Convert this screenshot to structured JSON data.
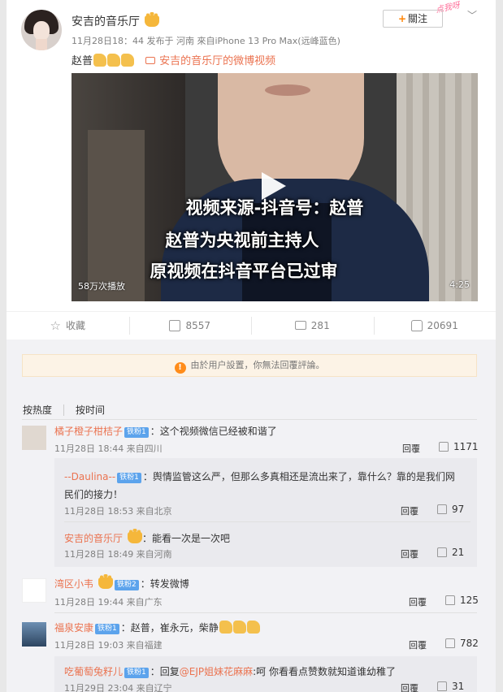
{
  "post": {
    "username": "安吉的音乐厅",
    "meta": "11月28日18：44 发布于 河南 來自iPhone 13 Pro Max(远峰蓝色)",
    "text": "赵普",
    "video_link": "安吉的音乐厅的微博视频",
    "follow_label": "關注",
    "sticker": "点我呀"
  },
  "video": {
    "caption_1": "视频来源-抖音号：赵普",
    "caption_2": "赵普为央视前主持人",
    "caption_3": "原视频在抖音平台已过审",
    "plays": "58万次播放",
    "duration": "4:25"
  },
  "actions": {
    "favorite": "收藏",
    "repost_count": "8557",
    "comment_count": "281",
    "like_count": "20691"
  },
  "notice": "由於用户設置，你無法回覆評論。",
  "sort": {
    "hot": "按热度",
    "time": "按时间"
  },
  "comments": [
    {
      "name": "橘子橙子柑桔子",
      "badge": "铁粉1",
      "text": "：这个视频微信已经被和谐了",
      "meta": "11月28日 18:44 来自四川",
      "reply": "回覆",
      "likes": "1171"
    },
    {
      "name": "--Daulina--",
      "badge": "铁粉1",
      "text_1": "：舆情监管这么严，但那么多真相还是流出来了，靠什么？靠的是我们网",
      "text_2": "民们的接力！",
      "meta": "11月28日 18:53 来自北京",
      "reply": "回覆",
      "likes": "97"
    },
    {
      "name": "安吉的音乐厅",
      "text": "：能看一次是一次吧",
      "meta": "11月28日 18:49 来自河南",
      "reply": "回覆",
      "likes": "21"
    },
    {
      "name": "湾区小韦",
      "badge": "铁粉2",
      "text": "：转发微博",
      "meta": "11月28日 19:44 来自广东",
      "reply": "回覆",
      "likes": "125"
    },
    {
      "name": "福泉安康",
      "badge": "铁粉1",
      "text": "：赵普，崔永元，柴静",
      "meta": "11月28日 19:03 来自福建",
      "reply": "回覆",
      "likes": "782"
    },
    {
      "name": "吃葡萄兔籽儿",
      "badge": "铁粉1",
      "text_pre": "：回复",
      "mention": "@EJP姐妹花麻麻",
      "text_post": ":呵 你看看点赞数就知道谁幼稚了",
      "meta": "11月29日 23:04 来自辽宁",
      "reply": "回覆",
      "likes": "31"
    }
  ],
  "colors": {
    "accent": "#eb7350",
    "badge": "#5ca3ec",
    "notice_bg": "#fcf3e6"
  }
}
